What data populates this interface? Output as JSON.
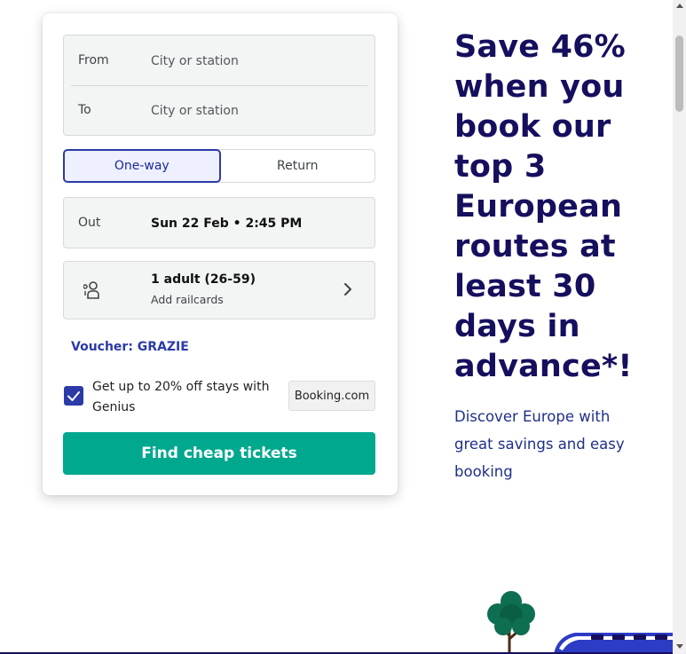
{
  "form": {
    "from_label": "From",
    "from_placeholder": "City or station",
    "to_label": "To",
    "to_placeholder": "City or station",
    "trip_types": [
      "One-way",
      "Return"
    ],
    "out_label": "Out",
    "out_value": "Sun 22 Feb • 2:45 PM",
    "passengers_main": "1 adult (26-59)",
    "passengers_sub": "Add railcards",
    "voucher": "Voucher: GRAZIE",
    "genius_text": "Get up to 20% off stays with Genius",
    "genius_checked": true,
    "partner_logo": "Booking.com",
    "submit_label": "Find cheap tickets"
  },
  "promo": {
    "title": "Save 46% when you book our top 3 European routes at least 30 days in advance*!",
    "subtitle": "Discover Europe with great savings and easy booking"
  },
  "colors": {
    "brand_navy": "#150f5e",
    "accent_blue": "#2c3aa8",
    "cta_green": "#00a88e"
  },
  "icons": {
    "passenger": "passenger-icon",
    "chevron": "chevron-right-icon",
    "check": "check-icon"
  }
}
